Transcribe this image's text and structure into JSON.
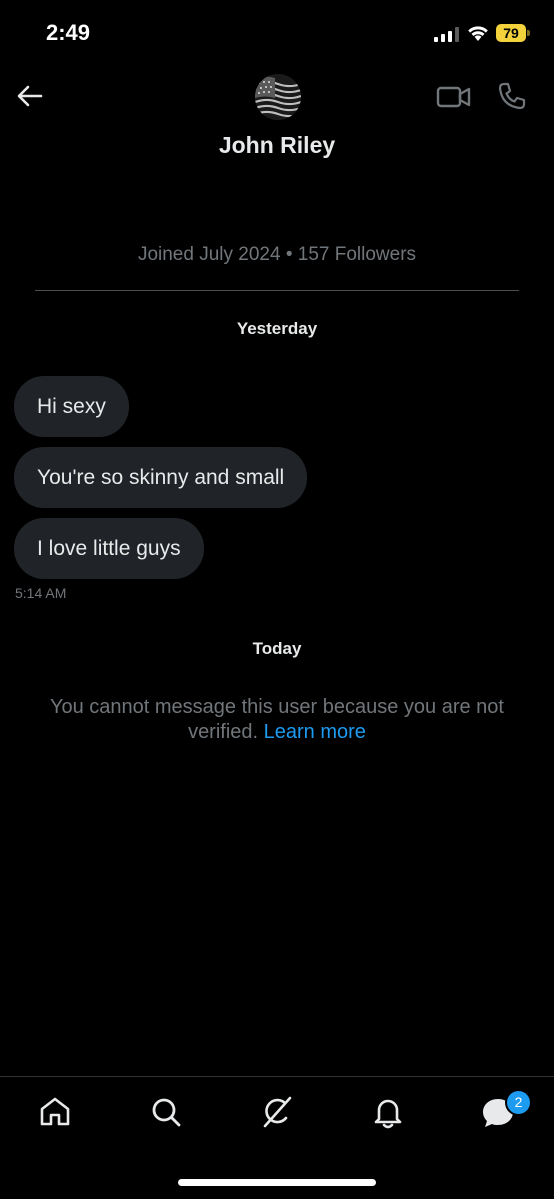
{
  "status_bar": {
    "time": "2:49",
    "battery": "79",
    "battery_color": "#f4d23c"
  },
  "header": {
    "back_icon": "arrow-left-icon",
    "contact_name": "John Riley",
    "video_icon": "video-camera-icon",
    "phone_icon": "phone-icon"
  },
  "profile_info": "Joined July 2024 • 157 Followers",
  "conversation": {
    "sections": [
      {
        "label": "Yesterday",
        "messages": [
          "Hi sexy",
          "You're so skinny and small",
          "I love little guys"
        ],
        "time": "5:14 AM"
      },
      {
        "label": "Today"
      }
    ],
    "notice_text": "You cannot message this user because you are not verified.",
    "notice_link": "Learn more",
    "link_color": "#1d9bf0"
  },
  "bottom_nav": {
    "items": [
      "home-icon",
      "search-icon",
      "grok-icon",
      "notifications-icon",
      "messages-icon"
    ],
    "messages_badge": "2"
  }
}
